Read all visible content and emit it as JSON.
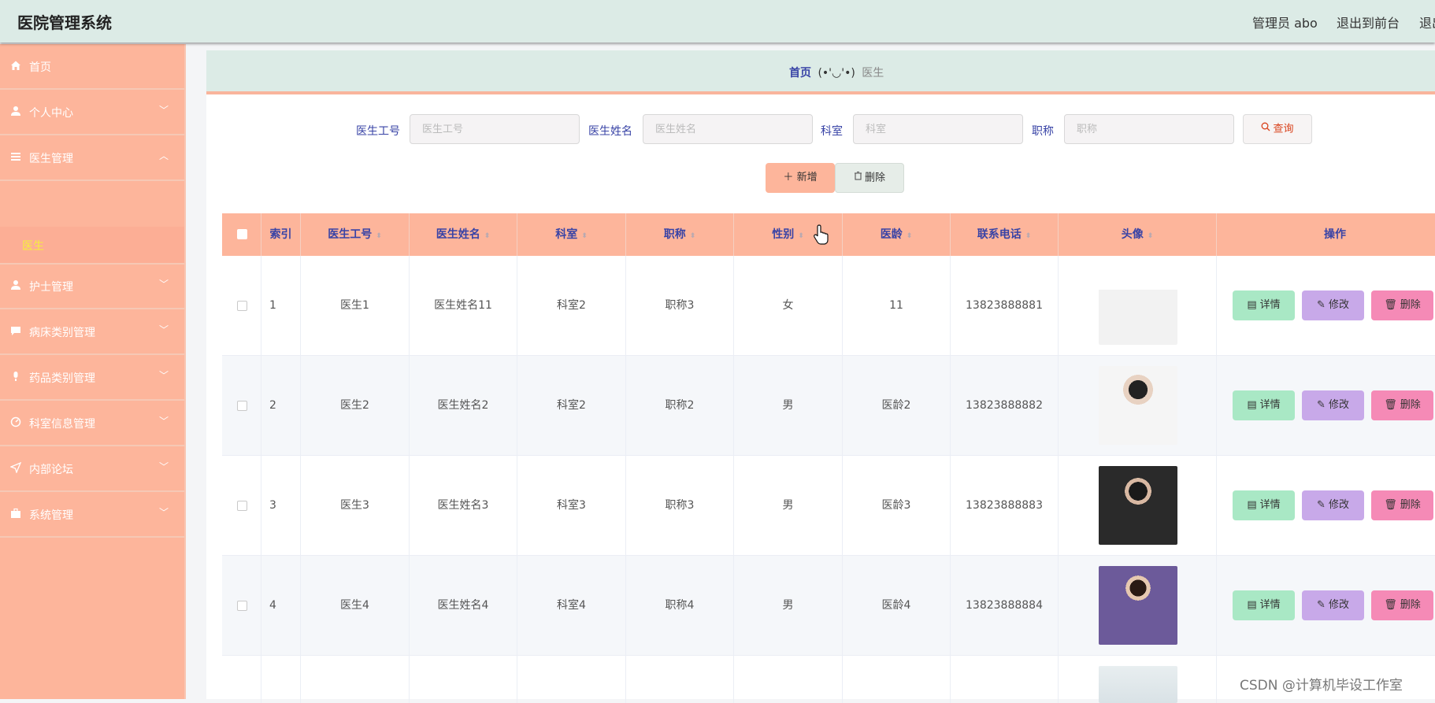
{
  "app": {
    "title": "医院管理系统"
  },
  "topbar": {
    "admin_label": "管理员 abo",
    "exit_front": "退出到前台",
    "exit_clipped": "退出"
  },
  "sidebar": {
    "items": [
      {
        "label": "首页",
        "icon": "home-icon"
      },
      {
        "label": "个人中心",
        "icon": "user-icon"
      },
      {
        "label": "医生管理",
        "icon": "list-icon"
      },
      {
        "label": "护士管理",
        "icon": "user-icon"
      },
      {
        "label": "病床类别管理",
        "icon": "chat-icon"
      },
      {
        "label": "药品类别管理",
        "icon": "microphone-icon"
      },
      {
        "label": "科室信息管理",
        "icon": "gauge-icon"
      },
      {
        "label": "内部论坛",
        "icon": "send-icon"
      },
      {
        "label": "系统管理",
        "icon": "briefcase-icon"
      }
    ],
    "sub_item": "医生"
  },
  "breadcrumb": {
    "home": "首页",
    "separator": "(•'◡'•)",
    "current": "医生"
  },
  "filters": {
    "id_label": "医生工号",
    "id_placeholder": "医生工号",
    "name_label": "医生姓名",
    "name_placeholder": "医生姓名",
    "dept_label": "科室",
    "dept_placeholder": "科室",
    "title_label": "职称",
    "title_placeholder": "职称",
    "query_button": "查询"
  },
  "actions": {
    "add": "新增",
    "delete": "删除"
  },
  "table": {
    "columns": [
      "索引",
      "医生工号",
      "医生姓名",
      "科室",
      "职称",
      "性别",
      "医龄",
      "联系电话",
      "头像",
      "操作"
    ],
    "rows": [
      {
        "index": "1",
        "id": "医生1",
        "name": "医生姓名11",
        "dept": "科室2",
        "title": "职称3",
        "gender": "女",
        "years": "11",
        "phone": "13823888881"
      },
      {
        "index": "2",
        "id": "医生2",
        "name": "医生姓名2",
        "dept": "科室2",
        "title": "职称2",
        "gender": "男",
        "years": "医龄2",
        "phone": "13823888882"
      },
      {
        "index": "3",
        "id": "医生3",
        "name": "医生姓名3",
        "dept": "科室3",
        "title": "职称3",
        "gender": "男",
        "years": "医龄3",
        "phone": "13823888883"
      },
      {
        "index": "4",
        "id": "医生4",
        "name": "医生姓名4",
        "dept": "科室4",
        "title": "职称4",
        "gender": "男",
        "years": "医龄4",
        "phone": "13823888884"
      }
    ],
    "row_actions": {
      "detail": "详情",
      "edit": "修改",
      "delete": "删除"
    }
  },
  "watermark": "CSDN @计算机毕设工作室"
}
